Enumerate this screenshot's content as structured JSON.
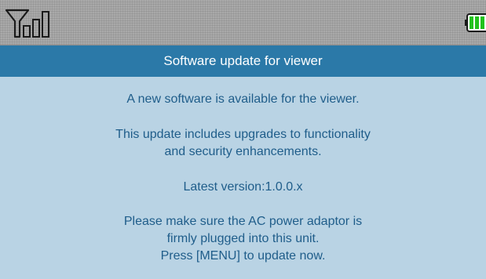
{
  "status_bar": {
    "signal_icon": "signal-strength-icon",
    "battery_icon": "battery-icon",
    "battery_color": "#22c21c"
  },
  "dialog": {
    "title": "Software update for viewer",
    "message_line1": "A new software is available for the viewer.",
    "message_line2a": "This update includes upgrades to functionality",
    "message_line2b": "and security enhancements.",
    "version": "Latest version:1.0.0.x",
    "instruction_line1": "Please make sure the AC power adaptor is",
    "instruction_line2": "firmly plugged into this unit.",
    "instruction_line3": "Press [MENU] to update now."
  },
  "colors": {
    "title_bar": "#2b79a8",
    "background": "#b9d3e4",
    "text": "#1f5d8a"
  }
}
